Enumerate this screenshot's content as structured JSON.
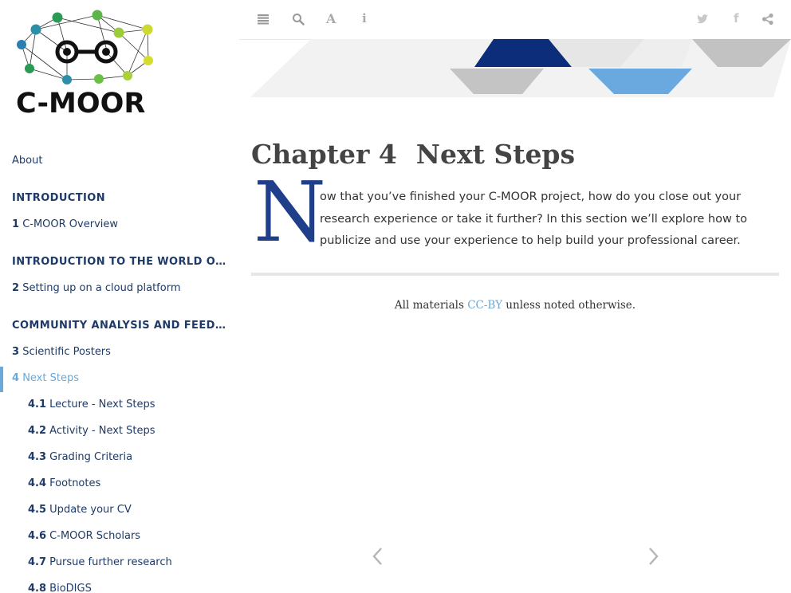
{
  "sidebar": {
    "logo_text": "C-MOOR",
    "about": "About",
    "parts": [
      "INTRODUCTION",
      "INTRODUCTION TO THE WORLD OF RESEARCH",
      "COMMUNITY ANALYSIS AND FEEDBACK"
    ],
    "chapters": [
      {
        "num": "1",
        "label": "C-MOOR Overview"
      },
      {
        "num": "2",
        "label": "Setting up on a cloud platform"
      },
      {
        "num": "3",
        "label": "Scientific Posters"
      },
      {
        "num": "4",
        "label": "Next Steps"
      }
    ],
    "sections": [
      {
        "num": "4.1",
        "label": "Lecture - Next Steps"
      },
      {
        "num": "4.2",
        "label": "Activity - Next Steps"
      },
      {
        "num": "4.3",
        "label": "Grading Criteria"
      },
      {
        "num": "4.4",
        "label": "Footnotes"
      },
      {
        "num": "4.5",
        "label": "Update your CV"
      },
      {
        "num": "4.6",
        "label": "C-MOOR Scholars"
      },
      {
        "num": "4.7",
        "label": "Pursue further research"
      },
      {
        "num": "4.8",
        "label": "BioDIGS"
      }
    ]
  },
  "toolbar": {
    "icons": [
      "menu-icon",
      "search-icon",
      "font-icon",
      "info-icon",
      "twitter-icon",
      "facebook-icon",
      "share-icon"
    ],
    "font_glyph": "A",
    "info_glyph": "i",
    "facebook_glyph": "f"
  },
  "main": {
    "chapter_number": "Chapter 4",
    "chapter_title": "Next Steps",
    "dropcap": "N",
    "intro_text": "ow that you’ve finished your C-MOOR project, how do you close out your research experience or take it further? In this section we’ll explore how to publicize and use your experience to help build your professional career.",
    "footer_prefix": "All materials ",
    "footer_link": "CC-BY",
    "footer_suffix": " unless noted otherwise."
  },
  "colors": {
    "navy": "#1e3a66",
    "accent": "#6aa9d8",
    "dropcap": "#1f3f8a",
    "banner_dark": "#0b2d7a",
    "banner_light_blue": "#6aa9e0"
  }
}
